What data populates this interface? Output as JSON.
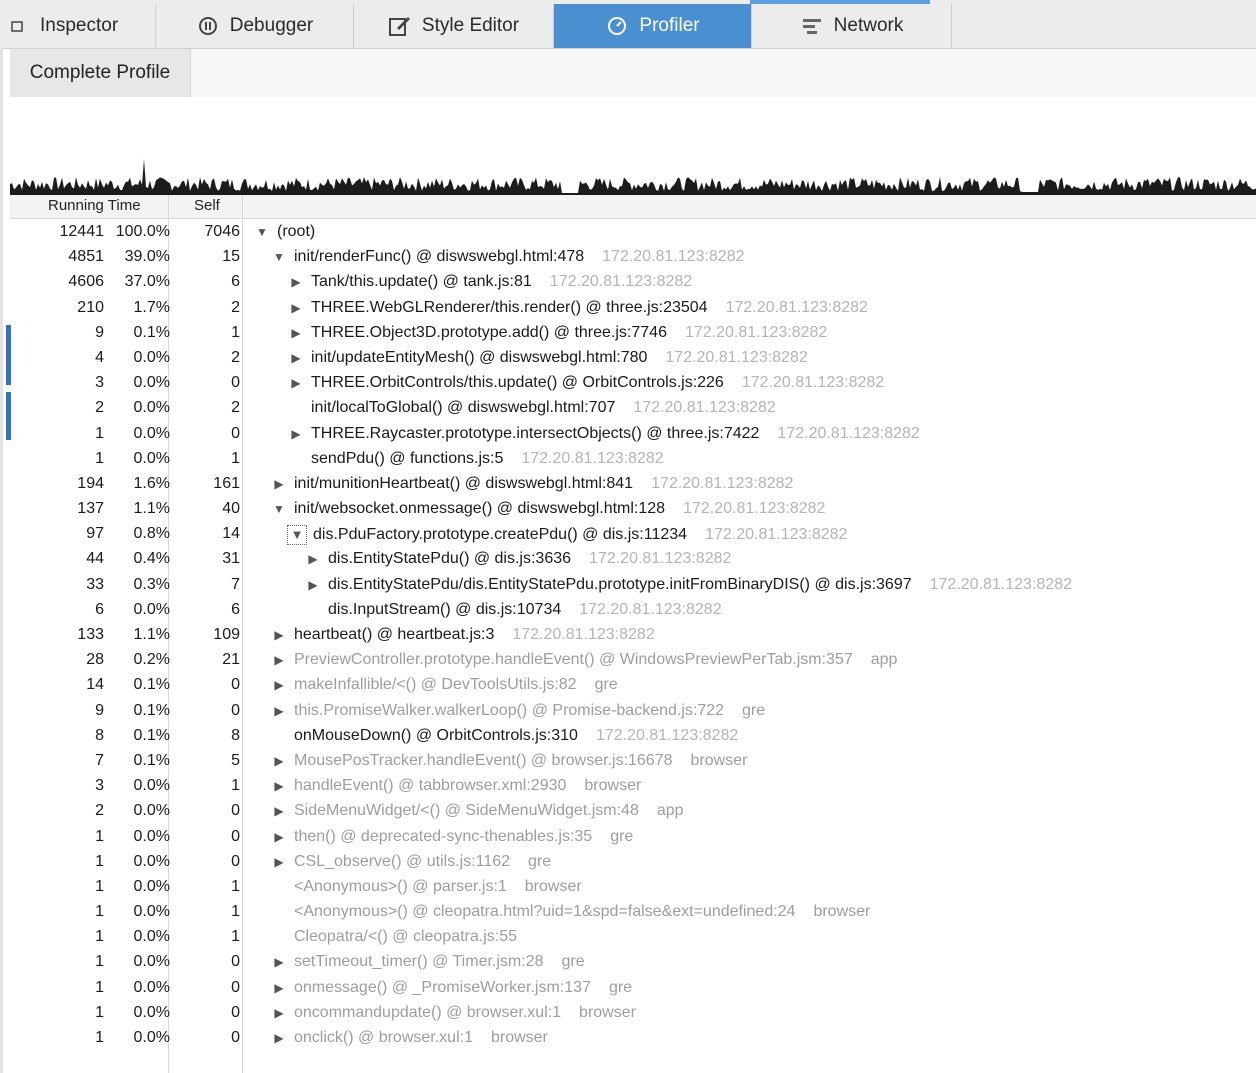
{
  "tabs": [
    {
      "label": "Inspector",
      "icon": "inspector-icon",
      "active": false
    },
    {
      "label": "Debugger",
      "icon": "debugger-icon",
      "active": false
    },
    {
      "label": "Style Editor",
      "icon": "style-editor-icon",
      "active": false
    },
    {
      "label": "Profiler",
      "icon": "profiler-icon",
      "active": true
    },
    {
      "label": "Network",
      "icon": "network-icon",
      "active": false
    }
  ],
  "profile_tab_label": "Complete Profile",
  "columns": {
    "running_time": "Running Time",
    "self": "Self"
  },
  "colors": {
    "active_tab": "#4a90d0",
    "host_text": "#b4b4b4",
    "system_text": "#9d9d9d"
  },
  "rows": [
    {
      "time": "12441",
      "pct": "100.0%",
      "self": "7046",
      "depth": 0,
      "twisty": "open",
      "fn": "(root)",
      "host": "",
      "sys": false
    },
    {
      "time": "4851",
      "pct": "39.0%",
      "self": "15",
      "depth": 1,
      "twisty": "open",
      "fn": "init/renderFunc() @ diswswebgl.html:478",
      "host": "172.20.81.123:8282",
      "sys": false
    },
    {
      "time": "4606",
      "pct": "37.0%",
      "self": "6",
      "depth": 2,
      "twisty": "closed",
      "fn": "Tank/this.update() @ tank.js:81",
      "host": "172.20.81.123:8282",
      "sys": false
    },
    {
      "time": "210",
      "pct": "1.7%",
      "self": "2",
      "depth": 2,
      "twisty": "closed",
      "fn": "THREE.WebGLRenderer/this.render() @ three.js:23504",
      "host": "172.20.81.123:8282",
      "sys": false
    },
    {
      "time": "9",
      "pct": "0.1%",
      "self": "1",
      "depth": 2,
      "twisty": "closed",
      "fn": "THREE.Object3D.prototype.add() @ three.js:7746",
      "host": "172.20.81.123:8282",
      "sys": false
    },
    {
      "time": "4",
      "pct": "0.0%",
      "self": "2",
      "depth": 2,
      "twisty": "closed",
      "fn": "init/updateEntityMesh() @ diswswebgl.html:780",
      "host": "172.20.81.123:8282",
      "sys": false
    },
    {
      "time": "3",
      "pct": "0.0%",
      "self": "0",
      "depth": 2,
      "twisty": "closed",
      "fn": "THREE.OrbitControls/this.update() @ OrbitControls.js:226",
      "host": "172.20.81.123:8282",
      "sys": false
    },
    {
      "time": "2",
      "pct": "0.0%",
      "self": "2",
      "depth": 2,
      "twisty": "none",
      "fn": "init/localToGlobal() @ diswswebgl.html:707",
      "host": "172.20.81.123:8282",
      "sys": false
    },
    {
      "time": "1",
      "pct": "0.0%",
      "self": "0",
      "depth": 2,
      "twisty": "closed",
      "fn": "THREE.Raycaster.prototype.intersectObjects() @ three.js:7422",
      "host": "172.20.81.123:8282",
      "sys": false
    },
    {
      "time": "1",
      "pct": "0.0%",
      "self": "1",
      "depth": 2,
      "twisty": "none",
      "fn": "sendPdu() @ functions.js:5",
      "host": "172.20.81.123:8282",
      "sys": false
    },
    {
      "time": "194",
      "pct": "1.6%",
      "self": "161",
      "depth": 1,
      "twisty": "closed",
      "fn": "init/munitionHeartbeat() @ diswswebgl.html:841",
      "host": "172.20.81.123:8282",
      "sys": false
    },
    {
      "time": "137",
      "pct": "1.1%",
      "self": "40",
      "depth": 1,
      "twisty": "open",
      "fn": "init/websocket.onmessage() @ diswswebgl.html:128",
      "host": "172.20.81.123:8282",
      "sys": false
    },
    {
      "time": "97",
      "pct": "0.8%",
      "self": "14",
      "depth": 2,
      "twisty": "open-boxed",
      "fn": "dis.PduFactory.prototype.createPdu() @ dis.js:11234",
      "host": "172.20.81.123:8282",
      "sys": false
    },
    {
      "time": "44",
      "pct": "0.4%",
      "self": "31",
      "depth": 3,
      "twisty": "closed",
      "fn": "dis.EntityStatePdu() @ dis.js:3636",
      "host": "172.20.81.123:8282",
      "sys": false
    },
    {
      "time": "33",
      "pct": "0.3%",
      "self": "7",
      "depth": 3,
      "twisty": "closed",
      "fn": "dis.EntityStatePdu/dis.EntityStatePdu.prototype.initFromBinaryDIS() @ dis.js:3697",
      "host": "172.20.81.123:8282",
      "sys": false
    },
    {
      "time": "6",
      "pct": "0.0%",
      "self": "6",
      "depth": 3,
      "twisty": "none",
      "fn": "dis.InputStream() @ dis.js:10734",
      "host": "172.20.81.123:8282",
      "sys": false
    },
    {
      "time": "133",
      "pct": "1.1%",
      "self": "109",
      "depth": 1,
      "twisty": "closed",
      "fn": "heartbeat() @ heartbeat.js:3",
      "host": "172.20.81.123:8282",
      "sys": false
    },
    {
      "time": "28",
      "pct": "0.2%",
      "self": "21",
      "depth": 1,
      "twisty": "closed",
      "fn": "PreviewController.prototype.handleEvent() @ WindowsPreviewPerTab.jsm:357",
      "host": "app",
      "sys": true
    },
    {
      "time": "14",
      "pct": "0.1%",
      "self": "0",
      "depth": 1,
      "twisty": "closed",
      "fn": "makeInfallible/<() @ DevToolsUtils.js:82",
      "host": "gre",
      "sys": true
    },
    {
      "time": "9",
      "pct": "0.1%",
      "self": "0",
      "depth": 1,
      "twisty": "closed",
      "fn": "this.PromiseWalker.walkerLoop() @ Promise-backend.js:722",
      "host": "gre",
      "sys": true
    },
    {
      "time": "8",
      "pct": "0.1%",
      "self": "8",
      "depth": 1,
      "twisty": "none",
      "fn": "onMouseDown() @ OrbitControls.js:310",
      "host": "172.20.81.123:8282",
      "sys": false
    },
    {
      "time": "7",
      "pct": "0.1%",
      "self": "5",
      "depth": 1,
      "twisty": "closed",
      "fn": "MousePosTracker.handleEvent() @ browser.js:16678",
      "host": "browser",
      "sys": true
    },
    {
      "time": "3",
      "pct": "0.0%",
      "self": "1",
      "depth": 1,
      "twisty": "closed",
      "fn": "handleEvent() @ tabbrowser.xml:2930",
      "host": "browser",
      "sys": true
    },
    {
      "time": "2",
      "pct": "0.0%",
      "self": "0",
      "depth": 1,
      "twisty": "closed",
      "fn": "SideMenuWidget/<() @ SideMenuWidget.jsm:48",
      "host": "app",
      "sys": true
    },
    {
      "time": "1",
      "pct": "0.0%",
      "self": "0",
      "depth": 1,
      "twisty": "closed",
      "fn": "then() @ deprecated-sync-thenables.js:35",
      "host": "gre",
      "sys": true
    },
    {
      "time": "1",
      "pct": "0.0%",
      "self": "0",
      "depth": 1,
      "twisty": "closed",
      "fn": "CSL_observe() @ utils.js:1162",
      "host": "gre",
      "sys": true
    },
    {
      "time": "1",
      "pct": "0.0%",
      "self": "1",
      "depth": 1,
      "twisty": "none",
      "fn": "<Anonymous>() @ parser.js:1",
      "host": "browser",
      "sys": true
    },
    {
      "time": "1",
      "pct": "0.0%",
      "self": "1",
      "depth": 1,
      "twisty": "none",
      "fn": "<Anonymous>() @ cleopatra.html?uid=1&spd=false&ext=undefined:24",
      "host": "browser",
      "sys": true
    },
    {
      "time": "1",
      "pct": "0.0%",
      "self": "1",
      "depth": 1,
      "twisty": "none",
      "fn": "Cleopatra/<() @ cleopatra.js:55",
      "host": "",
      "sys": true
    },
    {
      "time": "1",
      "pct": "0.0%",
      "self": "0",
      "depth": 1,
      "twisty": "closed",
      "fn": "setTimeout_timer() @ Timer.jsm:28",
      "host": "gre",
      "sys": true
    },
    {
      "time": "1",
      "pct": "0.0%",
      "self": "0",
      "depth": 1,
      "twisty": "closed",
      "fn": "onmessage() @ _PromiseWorker.jsm:137",
      "host": "gre",
      "sys": true
    },
    {
      "time": "1",
      "pct": "0.0%",
      "self": "0",
      "depth": 1,
      "twisty": "closed",
      "fn": "oncommandupdate() @ browser.xul:1",
      "host": "browser",
      "sys": true
    },
    {
      "time": "1",
      "pct": "0.0%",
      "self": "0",
      "depth": 1,
      "twisty": "closed",
      "fn": "onclick() @ browser.xul:1",
      "host": "browser",
      "sys": true
    }
  ]
}
